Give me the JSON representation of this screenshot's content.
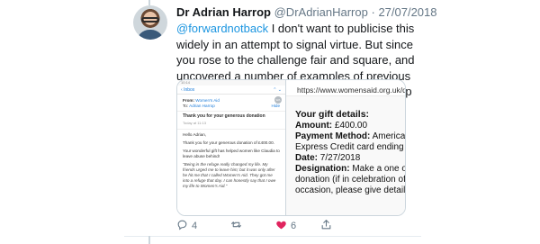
{
  "tweet": {
    "author_name": "Dr Adrian Harrop",
    "author_handle": "@DrAdrianHarrop",
    "separator": "·",
    "date": "27/07/2018",
    "mention": "@forwardnotback",
    "text": " I don't want to publicise this widely in an attempt to signal virtue. But since you rose to the challenge fair and square, and uncovered a number of examples of previous indiscretions, it is only right that I should keep to my side of the deal."
  },
  "email_screenshot": {
    "status_bar": "10:14",
    "nav_back": "Inbox",
    "nav_arrows": "⌃ ⌄",
    "from_label": "From:",
    "from_value": "Women's Aid",
    "to_label": "To:",
    "to_value": "Adrian Harrop",
    "hide_label": "Hide",
    "badge": "WA",
    "subject": "Thank you for your generous donation",
    "time": "Today at 11:13",
    "greeting": "Hello Adrian,",
    "thanks": "Thank you for your generous donation of £400.00.",
    "impact": "Your wonderful gift has helped women like Claudia to leave abuse behind!",
    "quote": "\"Being in the refuge really changed my life. My friends urged me to leave him; but it was only after he hit me that I called Women's Aid. They got me into a refuge that day. I can honestly say that I owe my life to Women's Aid.\""
  },
  "receipt": {
    "url": "https://www.womensaid.org.uk/do",
    "title": "Your gift details:",
    "amount_label": "Amount:",
    "amount_value": "£400.00",
    "payment_label": "Payment Method:",
    "payment_value_1": "American",
    "payment_value_2": "Express Credit card ending i",
    "date_label": "Date:",
    "date_value": "7/27/2018",
    "designation_label": "Designation:",
    "designation_value_1": "Make a one of",
    "designation_value_2": "donation (if in celebration of",
    "designation_value_3": "occasion, please give details"
  },
  "actions": {
    "reply_count": "4",
    "retweet_count": "",
    "like_count": "6",
    "share_count": ""
  },
  "colors": {
    "mention": "#1b95e0",
    "like_heart": "#e0245e",
    "icon_gray": "#657786"
  },
  "icons": [
    "reply-icon",
    "retweet-icon",
    "heart-icon",
    "share-icon"
  ]
}
